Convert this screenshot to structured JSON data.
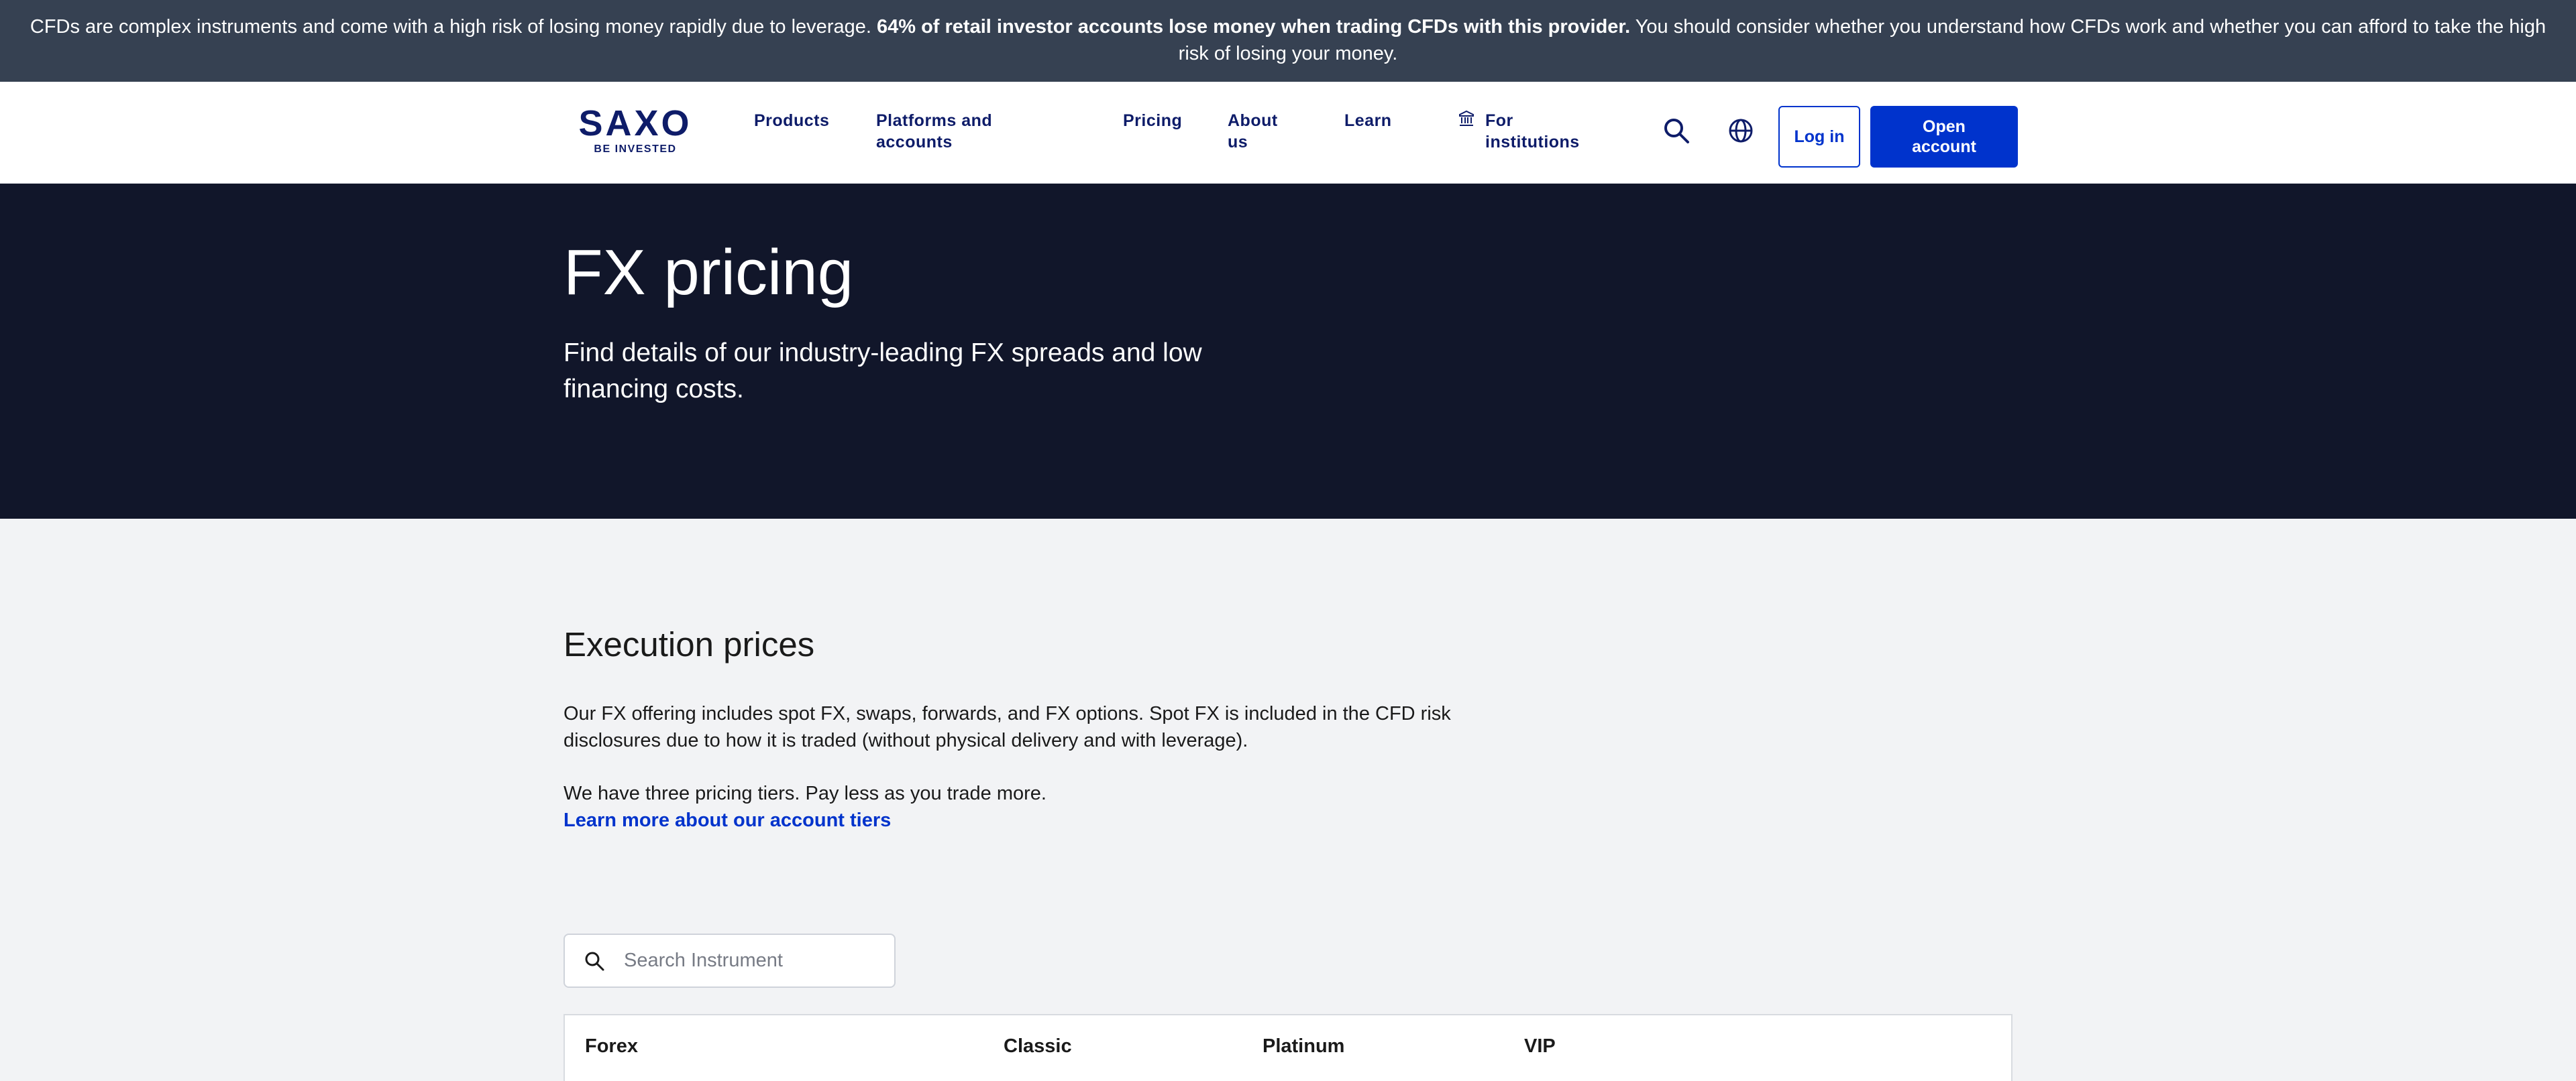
{
  "risk_banner": {
    "text_before": "CFDs are complex instruments and come with a high risk of losing money rapidly due to leverage. ",
    "text_bold": "64% of retail investor accounts lose money when trading CFDs with this provider.",
    "text_after": " You should consider whether you understand how CFDs work and whether you can afford to take the high risk of losing your money."
  },
  "nav": {
    "logo_word": "SAXO",
    "logo_tagline": "BE INVESTED",
    "links": {
      "products": "Products",
      "platforms": "Platforms and accounts",
      "pricing": "Pricing",
      "about": "About us",
      "learn": "Learn",
      "institutions": "For institutions"
    },
    "login_label": "Log in",
    "open_account_label": "Open account"
  },
  "hero": {
    "title": "FX pricing",
    "subtitle": "Find details of our industry-leading FX spreads and low financing costs."
  },
  "execution": {
    "title": "Execution prices",
    "paragraph_1": "Our FX offering includes spot FX, swaps, forwards, and FX options. Spot FX is included in the CFD risk disclosures due to how it is traded (without physical delivery and with leverage).",
    "paragraph_2": "We have three pricing tiers. Pay less as you trade more.",
    "link_label": "Learn more about our account tiers"
  },
  "search": {
    "placeholder": "Search Instrument"
  },
  "table": {
    "headers": [
      "Forex",
      "Classic",
      "Platinum",
      "VIP"
    ]
  },
  "colors": {
    "banner_bg": "#364152",
    "brand_navy": "#0e1c69",
    "brand_blue": "#0033cc",
    "hero_bg": "#11162a",
    "page_bg": "#f2f3f5"
  }
}
